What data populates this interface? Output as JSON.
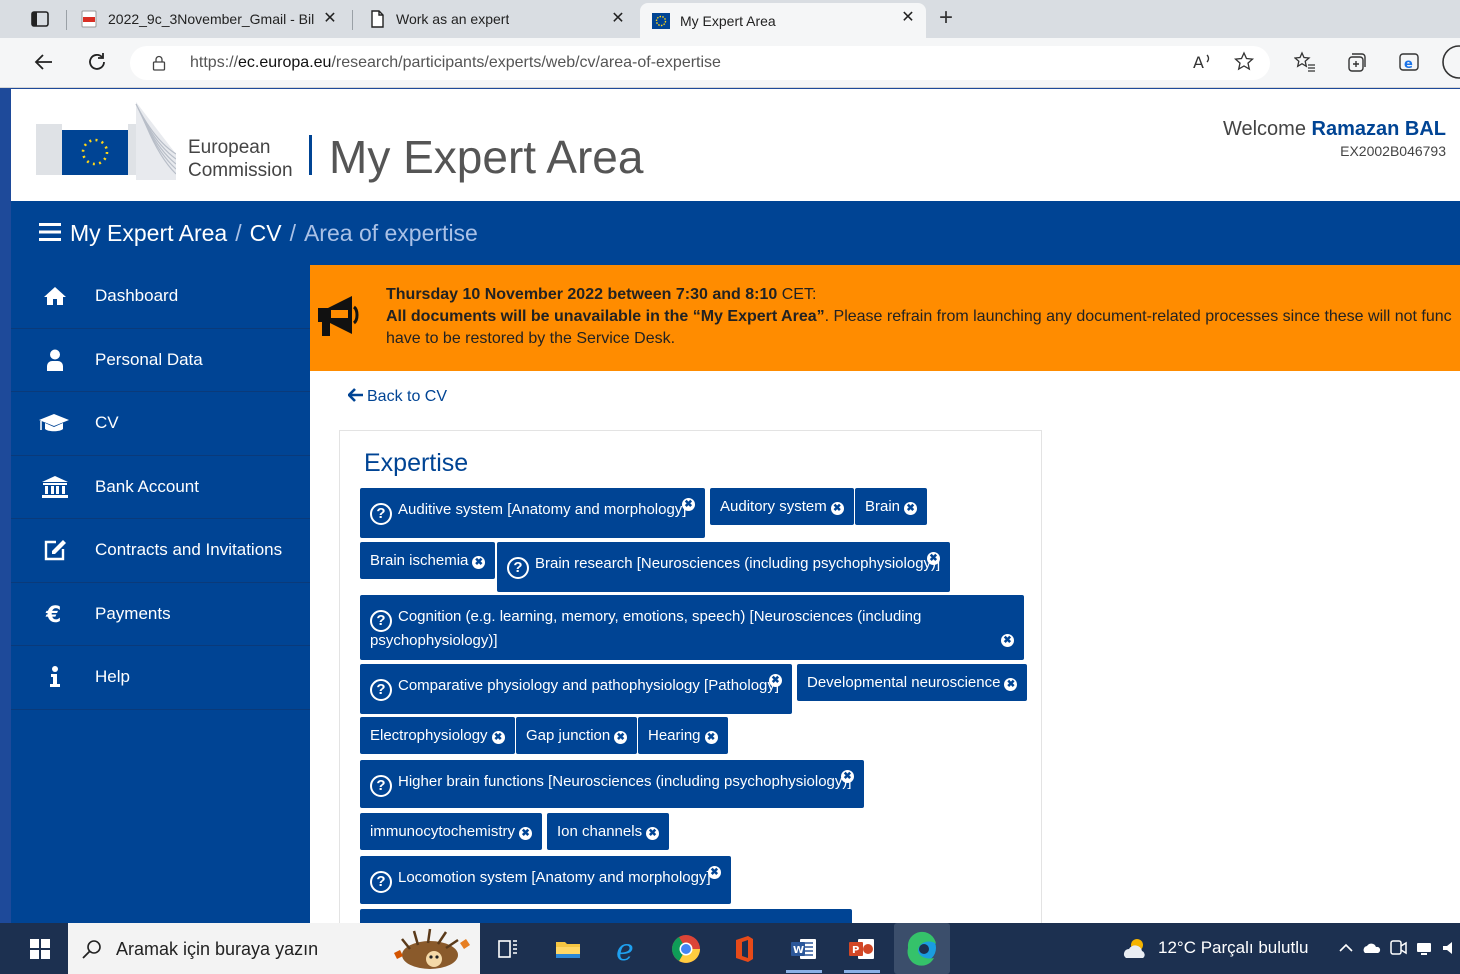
{
  "browser": {
    "tabs": [
      {
        "title": "2022_9c_3November_Gmail - Bil",
        "icon": "pdf-icon"
      },
      {
        "title": "Work as an expert",
        "icon": "page-icon"
      },
      {
        "title": "My Expert Area",
        "icon": "eu-flag-icon"
      }
    ],
    "url_prefix": "https://",
    "url_domain": "ec.europa.eu",
    "url_path": "/research/participants/experts/web/cv/area-of-expertise"
  },
  "header": {
    "org_line1": "European",
    "org_line2": "Commission",
    "site_title": "My Expert Area",
    "welcome": "Welcome",
    "user_name": "Ramazan BAL",
    "expert_id": "EX2002B046793"
  },
  "breadcrumb": {
    "items": [
      "My Expert Area",
      "CV"
    ],
    "separator": "/",
    "current": "Area of expertise"
  },
  "sidebar": {
    "items": [
      {
        "label": "Dashboard",
        "icon": "home-icon"
      },
      {
        "label": "Personal Data",
        "icon": "user-icon"
      },
      {
        "label": "CV",
        "icon": "graduation-cap-icon"
      },
      {
        "label": "Bank Account",
        "icon": "bank-icon"
      },
      {
        "label": "Contracts and Invitations",
        "icon": "edit-icon"
      },
      {
        "label": "Payments",
        "icon": "euro-icon"
      },
      {
        "label": "Help",
        "icon": "info-icon"
      }
    ]
  },
  "notice": {
    "date_bold": "Thursday 10 November 2022 between 7:30 and 8:10",
    "date_tz": " CET:",
    "line2_bold": "All documents will be unavailable in the “My Expert Area”",
    "line2_rest": ". Please refrain from launching any document-related processes since these will not func",
    "line3": "have to be restored by the Service Desk."
  },
  "back_link": "Back to CV",
  "expertise": {
    "title": "Expertise",
    "tags": [
      "Auditive system [Anatomy and morphology]",
      "Auditory system",
      "Brain",
      "Brain ischemia",
      "Brain research [Neurosciences (including psychophysiology)]",
      "Cognition (e.g. learning, memory, emotions, speech) [Neurosciences (including",
      "psychophysiology)]",
      "Comparative physiology and pathophysiology [Pathology]",
      "Developmental neuroscience",
      "Electrophysiology",
      "Gap junction",
      "Hearing",
      "Higher brain functions [Neurosciences (including psychophysiology)]",
      "immunocytochemistry",
      "Ion channels",
      "Locomotion system [Anatomy and morphology]"
    ],
    "help_glyph": "?",
    "remove_glyph": "✖"
  },
  "taskbar": {
    "search_placeholder": "Aramak için buraya yazın",
    "weather": "12°C  Parçalı bulutlu",
    "apps": [
      "task-view-icon",
      "file-explorer-icon",
      "internet-explorer-icon",
      "chrome-icon",
      "office-icon",
      "word-icon",
      "powerpoint-icon",
      "edge-icon"
    ]
  },
  "colors": {
    "ec_blue": "#004494",
    "notice_orange": "#ff8c00"
  }
}
